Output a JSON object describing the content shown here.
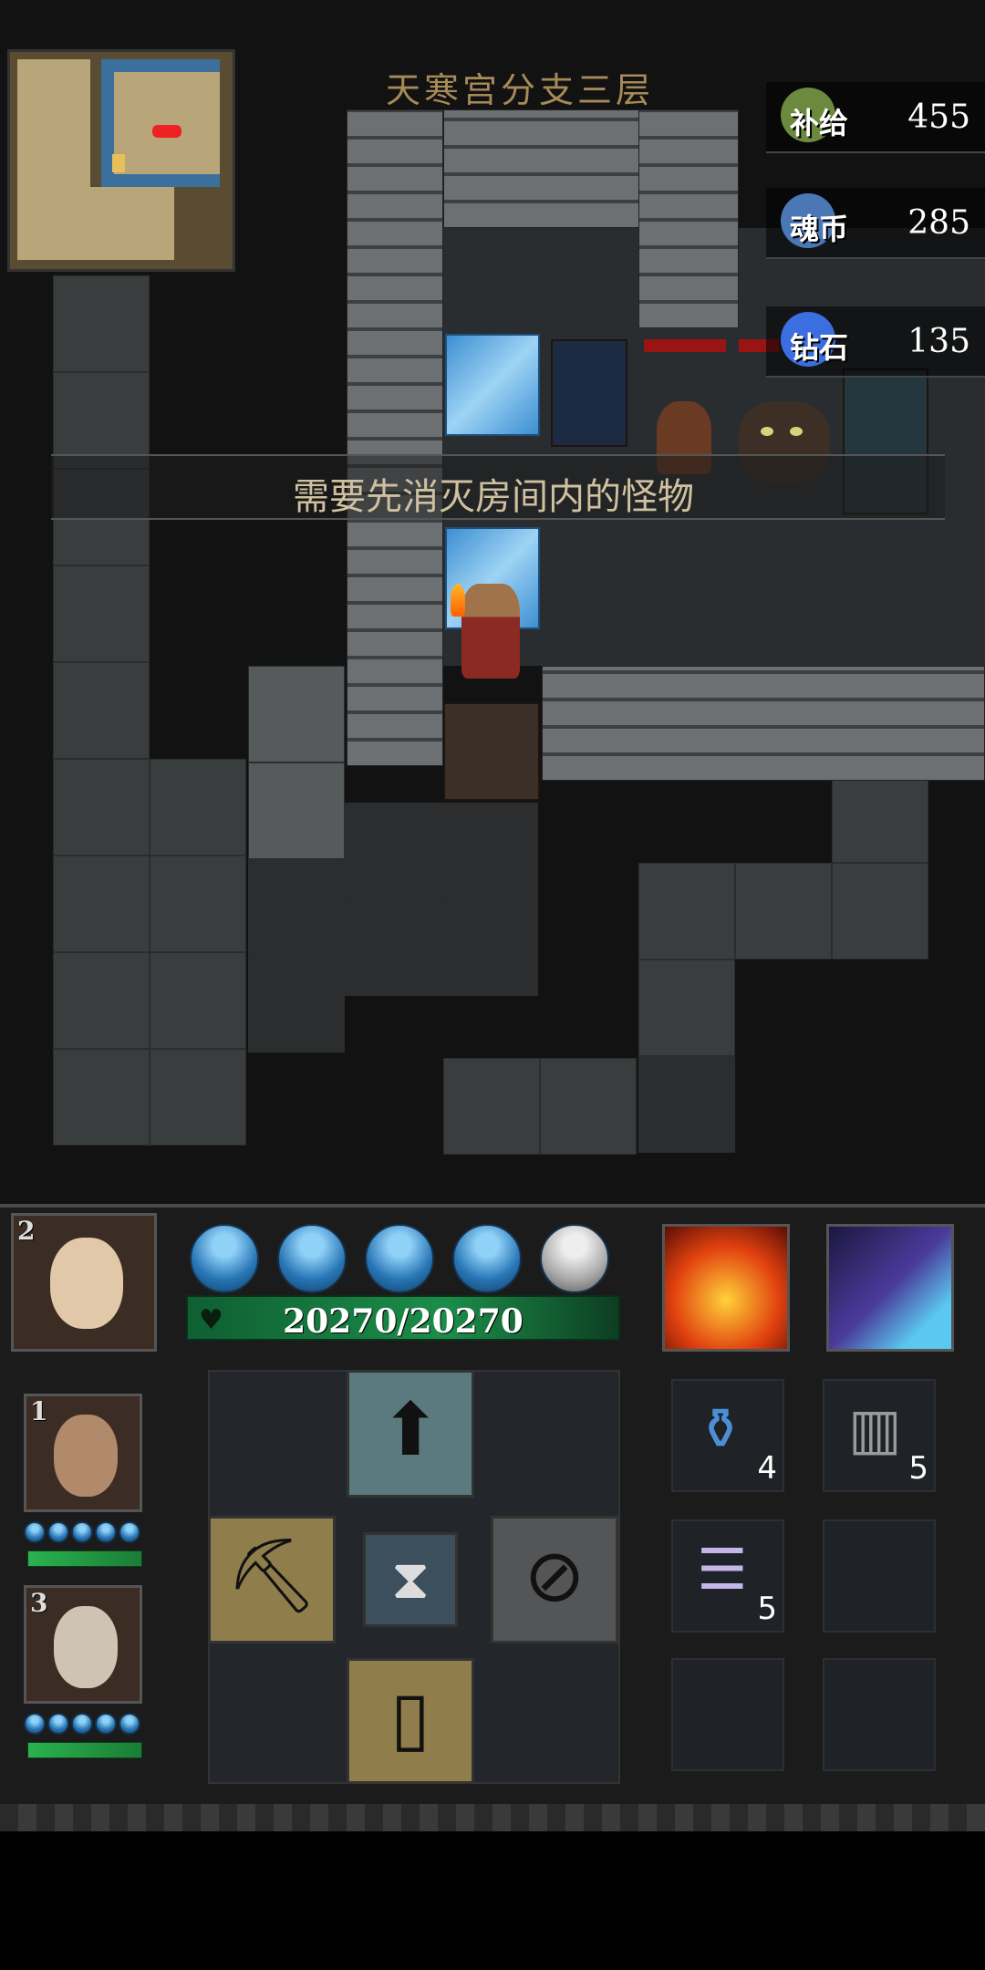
{
  "header": {
    "floor_title": "天寒宫分支三层"
  },
  "resources": [
    {
      "label": "补给",
      "value": "455",
      "icon": "supply-bag-icon",
      "color": "#6b8a3d"
    },
    {
      "label": "魂币",
      "value": "285",
      "icon": "soul-coin-icon",
      "color": "#4a78b5"
    },
    {
      "label": "钻石",
      "value": "135",
      "icon": "diamond-icon",
      "color": "#3b6ee0"
    }
  ],
  "notice": {
    "text": "需要先消灭房间内的怪物"
  },
  "active_hero": {
    "slot": "2",
    "hp_text": "20270/20270",
    "hp_fraction": 1.0,
    "spirit_orbs": 5,
    "spirit_orbs_full": 4
  },
  "party": [
    {
      "slot": "1",
      "spirit_orbs": 5,
      "hp_fraction": 1.0
    },
    {
      "slot": "3",
      "spirit_orbs": 5,
      "hp_fraction": 1.0
    }
  ],
  "skills": [
    {
      "name": "fire-burst-skill-icon",
      "color": "#d63a13"
    },
    {
      "name": "dash-skill-icon",
      "color": "#3f2b7a"
    }
  ],
  "controls": {
    "up_icon": "arrow-up-icon",
    "dig_icon": "shovel-icon",
    "wait_icon": "hourglass-icon",
    "cancel_icon": "forbidden-icon",
    "exit_icon": "door-icon"
  },
  "inventory": [
    {
      "icon": "blue-potion-icon",
      "count": "4"
    },
    {
      "icon": "scroll-bundle-icon",
      "count": "5"
    },
    {
      "icon": "talisman-paper-icon",
      "count": "5"
    },
    {
      "icon": "",
      "count": ""
    },
    {
      "icon": "",
      "count": ""
    },
    {
      "icon": "",
      "count": ""
    }
  ],
  "colors": {
    "accent_gold": "#a88a58",
    "hp_green": "#1b8d49",
    "spirit_blue": "#2876b6"
  }
}
